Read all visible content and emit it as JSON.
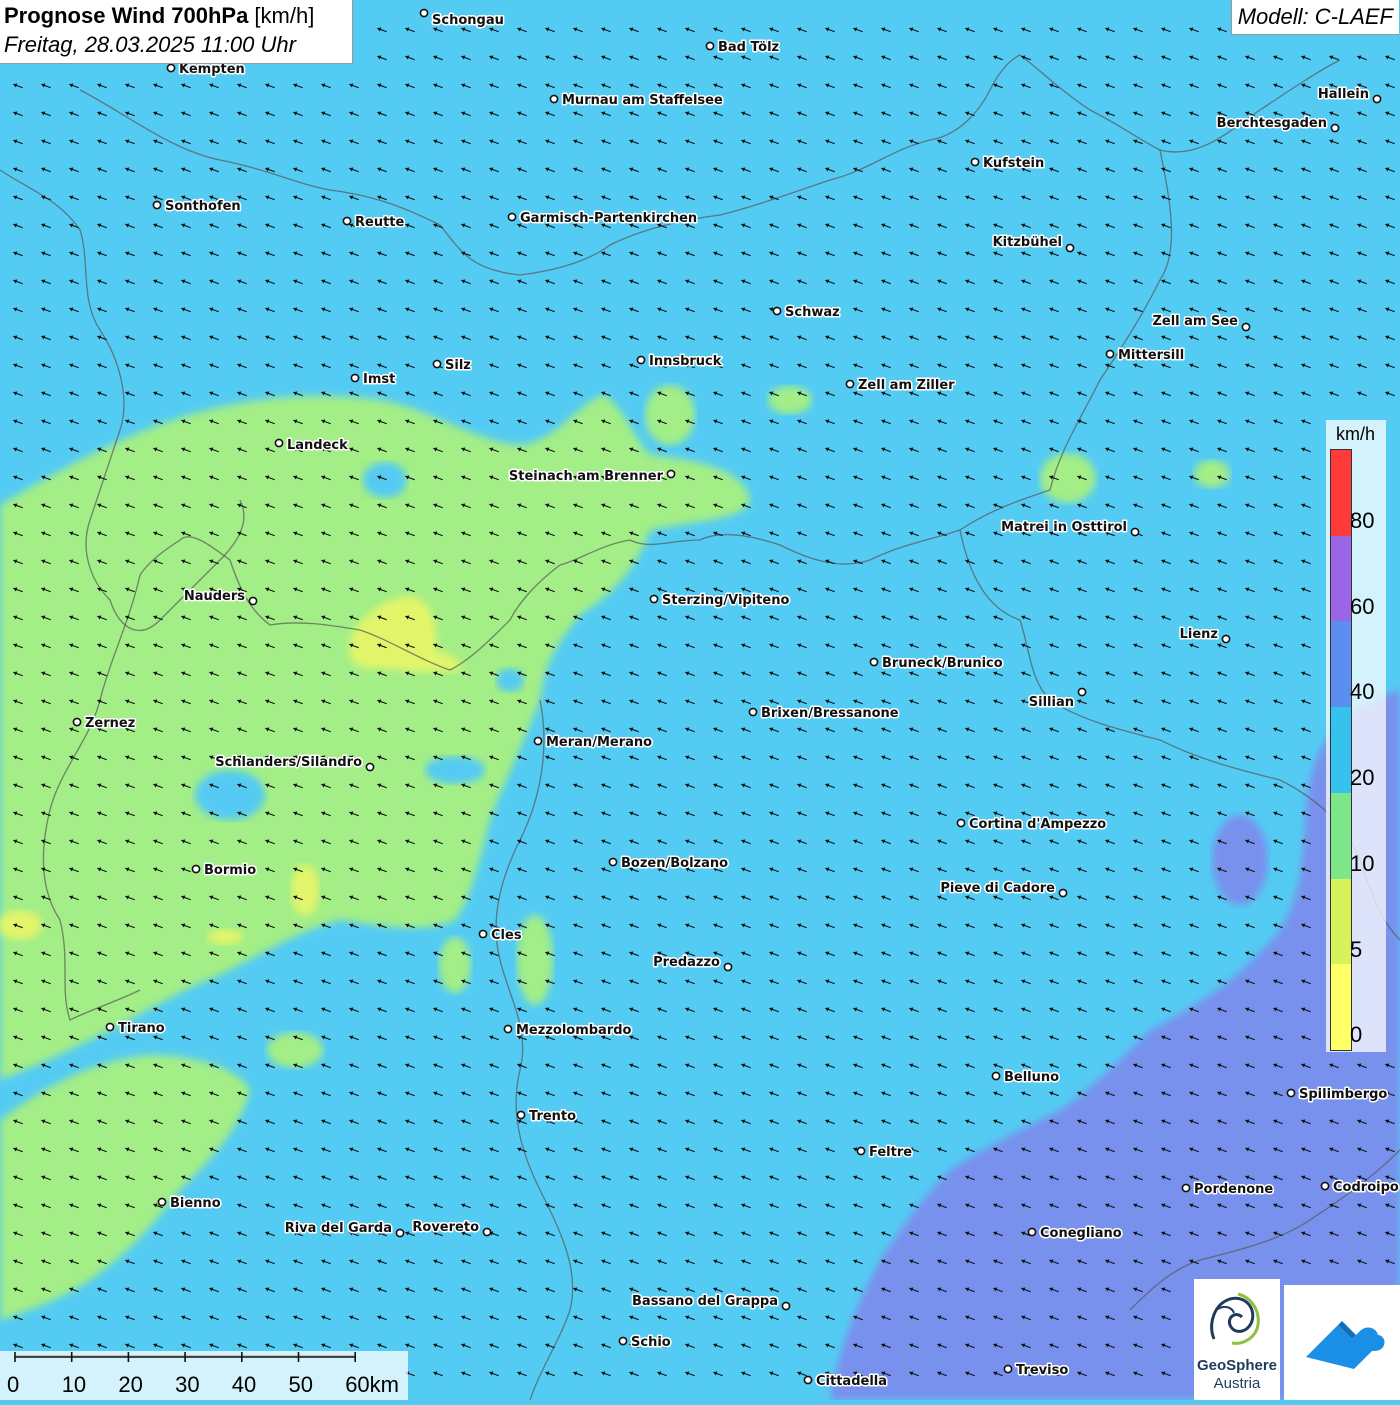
{
  "header": {
    "title_bold": "Prognose Wind 700hPa",
    "title_unit": " [km/h]",
    "datetime": "Freitag, 28.03.2025 11:00 Uhr",
    "model": "Modell: C-LAEF"
  },
  "legend": {
    "unit": "km/h",
    "labels": [
      "80",
      "60",
      "40",
      "20",
      "10",
      "5",
      "0"
    ],
    "colors": [
      "#ff3a3a",
      "#9a66e6",
      "#5c8ef0",
      "#36c2ee",
      "#7ee68a",
      "#d8f25a",
      "#ffff66"
    ]
  },
  "scale_bar": {
    "labels": [
      "0",
      "10",
      "20",
      "30",
      "40",
      "50",
      "60km"
    ]
  },
  "wind": {
    "predominant_direction": "from east-north-east",
    "fill_colors": {
      "weak": "#a3ee86",
      "very_weak": "#e2f56a",
      "moderate": "#54cbf3",
      "strong": "#7891ed"
    }
  },
  "cities": [
    {
      "name": "Schongau"
    },
    {
      "name": "Bad Tölz"
    },
    {
      "name": "Kempten"
    },
    {
      "name": "Murnau am Staffelsee"
    },
    {
      "name": "Hallein"
    },
    {
      "name": "Berchtesgaden"
    },
    {
      "name": "Kufstein"
    },
    {
      "name": "Sonthofen"
    },
    {
      "name": "Reutte"
    },
    {
      "name": "Garmisch-Partenkirchen"
    },
    {
      "name": "Kitzbühel"
    },
    {
      "name": "Schwaz"
    },
    {
      "name": "Zell am See"
    },
    {
      "name": "Mittersill"
    },
    {
      "name": "Innsbruck"
    },
    {
      "name": "Silz"
    },
    {
      "name": "Imst"
    },
    {
      "name": "Zell am Ziller"
    },
    {
      "name": "Landeck"
    },
    {
      "name": "Steinach am Brenner"
    },
    {
      "name": "Matrei in Osttirol"
    },
    {
      "name": "Nauders"
    },
    {
      "name": "Sterzing/Vipiteno"
    },
    {
      "name": "Lienz"
    },
    {
      "name": "Bruneck/Brunico"
    },
    {
      "name": "Sillian"
    },
    {
      "name": "Brixen/Bressanone"
    },
    {
      "name": "Zernez"
    },
    {
      "name": "Meran/Merano"
    },
    {
      "name": "Schlanders/Silandro"
    },
    {
      "name": "Cortina d'Ampezzo"
    },
    {
      "name": "Bozen/Bolzano"
    },
    {
      "name": "Bormio"
    },
    {
      "name": "Pieve di Cadore"
    },
    {
      "name": "Cles"
    },
    {
      "name": "Predazzo"
    },
    {
      "name": "Tirano"
    },
    {
      "name": "Mezzolombardo"
    },
    {
      "name": "Belluno"
    },
    {
      "name": "Spilimbergo"
    },
    {
      "name": "Trento"
    },
    {
      "name": "Feltre"
    },
    {
      "name": "Pordenone"
    },
    {
      "name": "Codroipo"
    },
    {
      "name": "Bienno"
    },
    {
      "name": "Riva del Garda"
    },
    {
      "name": "Rovereto"
    },
    {
      "name": "Conegliano"
    },
    {
      "name": "Bassano del Grappa"
    },
    {
      "name": "Schio"
    },
    {
      "name": "Treviso"
    },
    {
      "name": "Cittadella"
    }
  ],
  "logos": {
    "geosphere_line1": "GeoSphere",
    "geosphere_line2": "Austria"
  }
}
